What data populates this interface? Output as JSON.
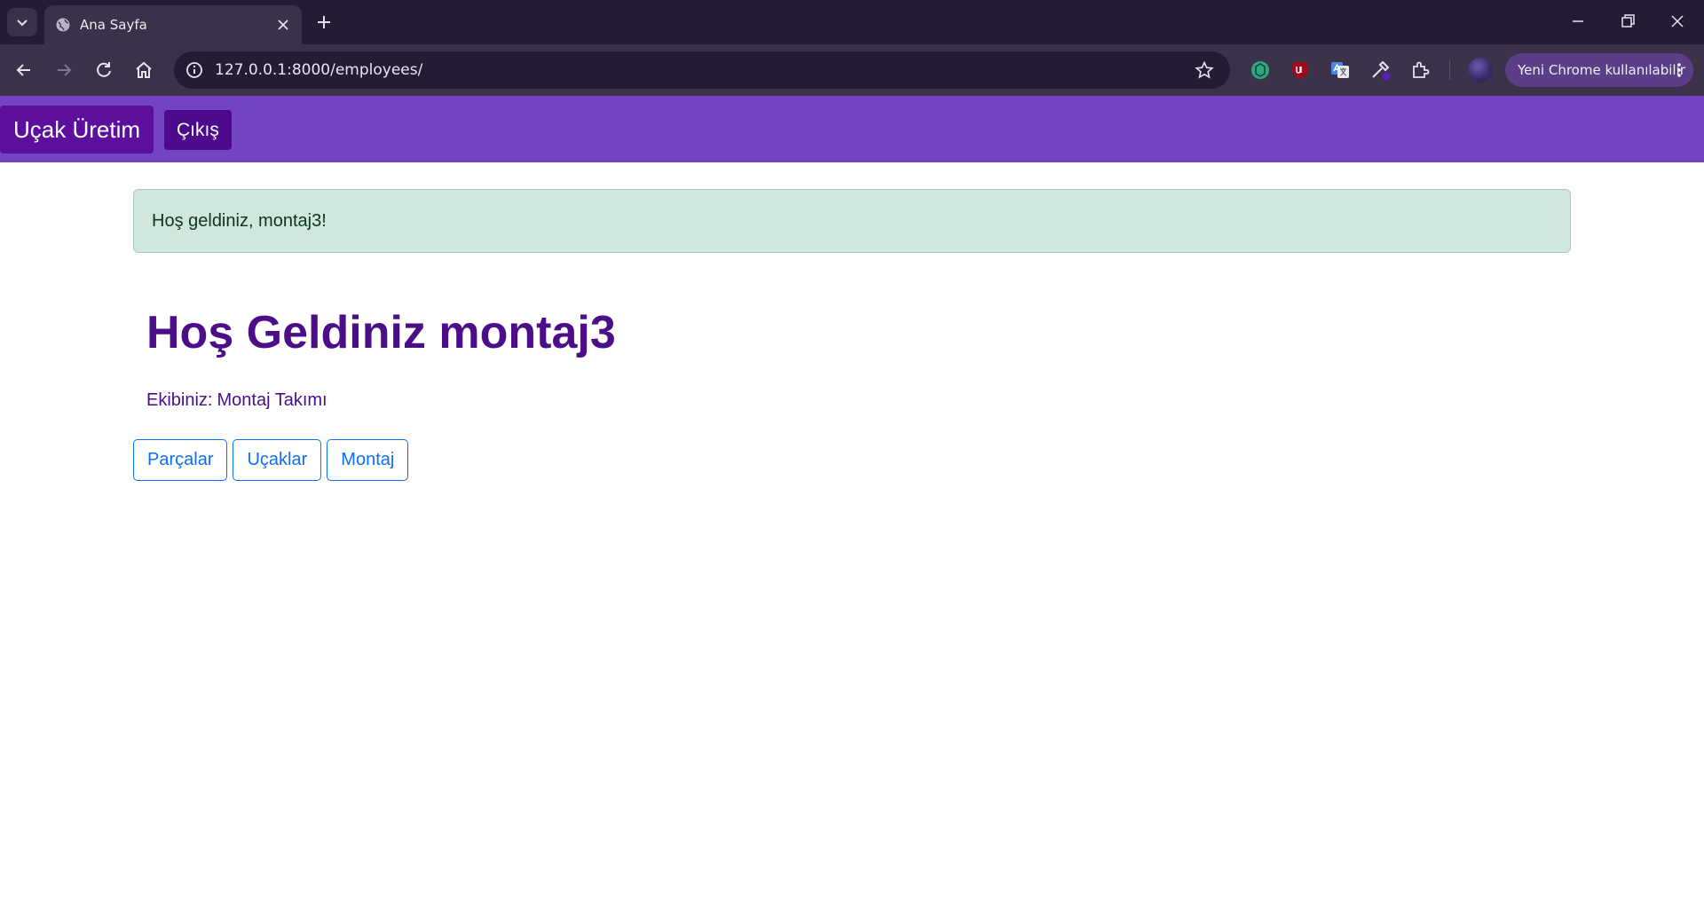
{
  "browser": {
    "tab_title": "Ana Sayfa",
    "url": "127.0.0.1:8000/employees/",
    "update_label": "Yeni Chrome kullanılabilir",
    "colors": {
      "tabbar": "#241c33",
      "toolbar": "#3b3249"
    }
  },
  "navbar": {
    "brand": "Uçak Üretim",
    "logout_label": "Çıkış",
    "colors": {
      "background": "#7244c4",
      "brand_background": "#5b0f9c"
    }
  },
  "alert": {
    "message": "Hoş geldiniz, montaj3!",
    "type": "success"
  },
  "main": {
    "heading": "Hoş Geldiniz montaj3",
    "team_label": "Ekibiniz:",
    "team_name": "Montaj Takımı",
    "buttons": [
      {
        "label": "Parçalar"
      },
      {
        "label": "Uçaklar"
      },
      {
        "label": "Montaj"
      }
    ]
  }
}
